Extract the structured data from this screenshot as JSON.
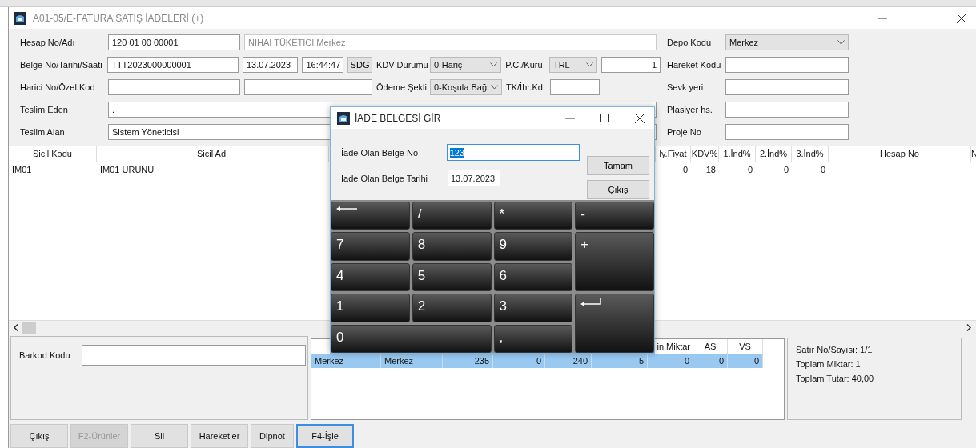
{
  "window": {
    "title": "A01-05/E-FATURA SATIŞ İADELERİ (+)"
  },
  "form": {
    "left_rows": [
      [
        {
          "kind": "label",
          "text": "Hesap No/Adı"
        },
        {
          "kind": "input",
          "value": "120 01 00 00001",
          "readonly": false
        },
        {
          "kind": "input",
          "value": "NİHAİ TÜKETİCİ Merkez",
          "readonly": true
        }
      ],
      [
        {
          "kind": "label",
          "text": "Belge No/Tarihi/Saati"
        },
        {
          "kind": "input",
          "value": "TTT2023000000001",
          "readonly": false
        },
        {
          "kind": "input",
          "value": "13.07.2023",
          "readonly": false
        },
        {
          "kind": "input",
          "value": "16:44:47",
          "readonly": false
        },
        {
          "kind": "button",
          "text": "SDG"
        },
        {
          "kind": "label",
          "text": "KDV Durumu"
        },
        {
          "kind": "select",
          "value": "0-Hariç"
        },
        {
          "kind": "label",
          "text": "P.C./Kuru"
        },
        {
          "kind": "select",
          "value": "TRL"
        },
        {
          "kind": "number",
          "value": "1",
          "readonly": false
        }
      ],
      [
        {
          "kind": "label",
          "text": "Harici No/Özel Kod"
        },
        {
          "kind": "input",
          "readonly": false
        },
        {
          "kind": "input",
          "readonly": false
        },
        {
          "kind": "label",
          "text": "Ödeme Şekli"
        },
        {
          "kind": "select",
          "value": "0-Koşula Bağ"
        },
        {
          "kind": "label",
          "text": "TK/İhr.Kd"
        },
        {
          "kind": "input",
          "readonly": false
        }
      ],
      [
        {
          "kind": "label",
          "text": "Teslim Eden"
        },
        {
          "kind": "input",
          "value": ".",
          "readonly": false
        }
      ],
      [
        {
          "kind": "label",
          "text": "Teslim Alan"
        },
        {
          "kind": "input",
          "value": "Sistem Yöneticisi",
          "readonly": false
        }
      ]
    ],
    "right_rows": [
      {
        "label": "Depo Kodu",
        "kind": "select",
        "value": "Merkez"
      },
      {
        "label": "Hareket Kodu",
        "kind": "input"
      },
      {
        "label": "Sevk yeri",
        "kind": "input"
      },
      {
        "label": "Plasiyer hs.",
        "kind": "input"
      },
      {
        "label": "Proje No",
        "kind": "input"
      }
    ]
  },
  "grid": {
    "columns": [
      "Sicil Kodu",
      "Sicil Adı",
      "ly.Fiyat",
      "KDV%",
      "1.İnd%",
      "2.İnd%",
      "3.İnd%",
      "Hesap No",
      "N"
    ],
    "rows": [
      {
        "cells": [
          "IM01",
          "IM01 ÜRÜNÜ",
          "0",
          "18",
          "0",
          "0",
          "0"
        ]
      }
    ]
  },
  "barcode": {
    "label": "Barkod Kodu"
  },
  "stock_grid": {
    "columns": [
      "",
      "",
      "",
      "",
      "",
      "",
      "in.Miktar",
      "AS",
      "VS"
    ],
    "rows": [
      {
        "cells": [
          "Merkez",
          "Merkez",
          "235",
          "0",
          "240",
          "5",
          "0",
          "0",
          "0"
        ],
        "selected": true
      }
    ]
  },
  "summary": [
    "Satır No/Sayısı: 1/1",
    "Toplam Miktar: 1",
    "Toplam Tutar: 40,00"
  ],
  "buttons": [
    {
      "label": "Çıkış",
      "disabled": false,
      "focused": false
    },
    {
      "label": "F2-Ürünler",
      "disabled": true,
      "focused": false
    },
    {
      "label": "Sil",
      "disabled": false,
      "focused": false
    },
    {
      "label": "Hareketler",
      "disabled": false,
      "focused": false
    },
    {
      "label": "Dipnot",
      "disabled": false,
      "focused": false
    },
    {
      "label": "F4-İşle",
      "disabled": false,
      "focused": true
    }
  ],
  "dialog": {
    "title": "İADE BELGESİ GİR",
    "fields": [
      {
        "label": "İade Olan Belge No",
        "value": "123",
        "selected": true
      },
      {
        "label": "İade Olan Belge Tarihi",
        "value": "13.07.2023",
        "selected": false
      }
    ],
    "buttons": [
      "Tamam",
      "Çıkış"
    ],
    "keys": [
      {
        "kind": "backspace"
      },
      {
        "kind": "char",
        "label": "/"
      },
      {
        "kind": "char",
        "label": "*"
      },
      {
        "kind": "char",
        "label": "-"
      },
      {
        "kind": "char",
        "label": "7"
      },
      {
        "kind": "char",
        "label": "8"
      },
      {
        "kind": "char",
        "label": "9"
      },
      {
        "kind": "tall",
        "label": "+"
      },
      {
        "kind": "char",
        "label": "4"
      },
      {
        "kind": "char",
        "label": "5"
      },
      {
        "kind": "char",
        "label": "6"
      },
      {
        "kind": "char",
        "label": "1"
      },
      {
        "kind": "char",
        "label": "2"
      },
      {
        "kind": "char",
        "label": "3"
      },
      {
        "kind": "enter"
      },
      {
        "kind": "wide",
        "label": "0"
      },
      {
        "kind": "char",
        "label": ","
      }
    ]
  }
}
